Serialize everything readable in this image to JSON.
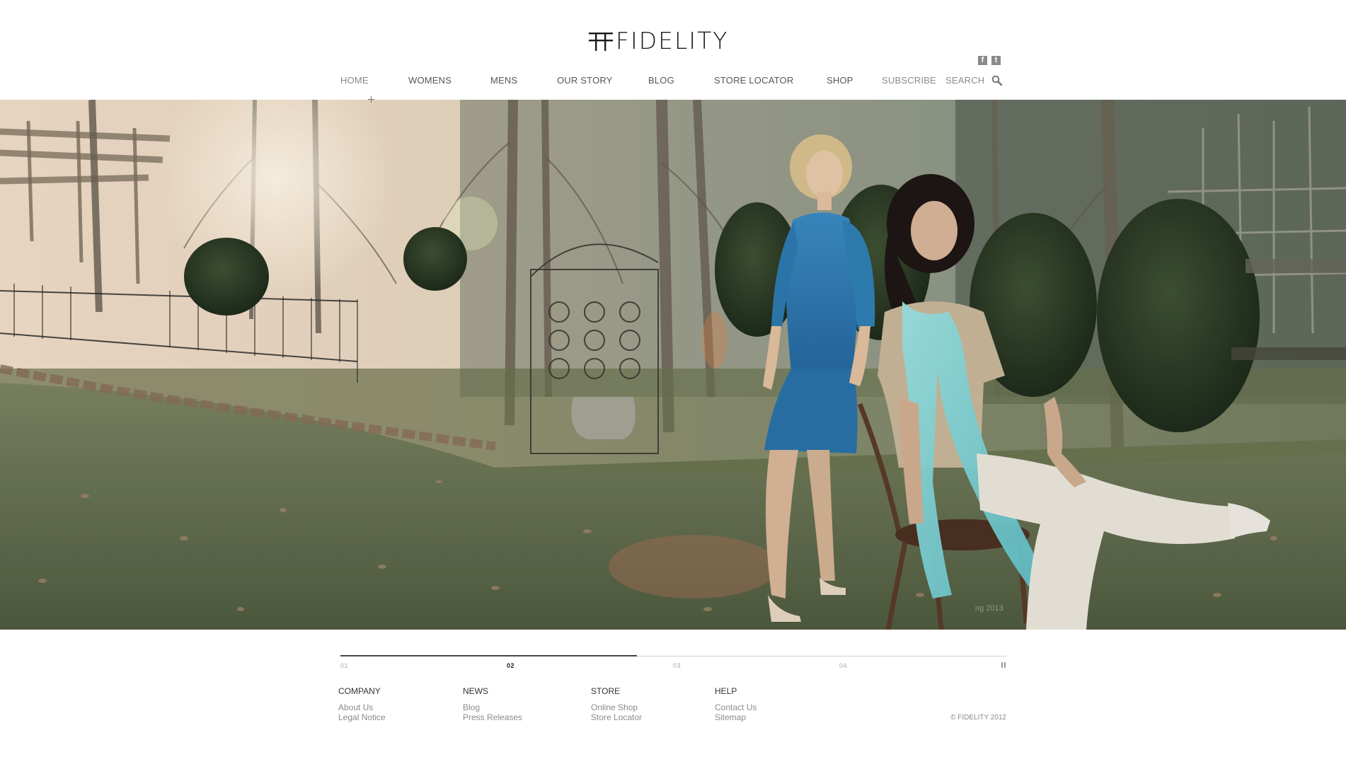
{
  "brand": {
    "name": "FIDELITY"
  },
  "social": [
    {
      "name": "facebook-icon",
      "glyph": "f"
    },
    {
      "name": "twitter-icon",
      "glyph": "t"
    }
  ],
  "nav": {
    "items": [
      {
        "label": "HOME",
        "active": true
      },
      {
        "label": "WOMENS"
      },
      {
        "label": "MENS"
      },
      {
        "label": "OUR STORY"
      },
      {
        "label": "BLOG"
      },
      {
        "label": "STORE LOCATOR"
      },
      {
        "label": "SHOP"
      },
      {
        "label": "SUBSCRIBE"
      },
      {
        "label": "SEARCH"
      }
    ]
  },
  "hero": {
    "watermark": "ng 2013",
    "colors": {
      "sky": "#f1ddc8",
      "grass": "#5d6b4a",
      "dress": "#2f7fb4",
      "scarf": "#7fd4d6"
    }
  },
  "slider": {
    "slides": [
      "01",
      "02",
      "03",
      "04"
    ],
    "active_index": 1,
    "progress": 0.445
  },
  "footer": {
    "columns": [
      {
        "heading": "COMPANY",
        "links": [
          "About Us",
          "Legal Notice"
        ]
      },
      {
        "heading": "NEWS",
        "links": [
          "Blog",
          "Press Releases"
        ]
      },
      {
        "heading": "STORE",
        "links": [
          "Online Shop",
          "Store Locator"
        ]
      },
      {
        "heading": "HELP",
        "links": [
          "Contact Us",
          "Sitemap"
        ]
      }
    ],
    "copyright": "© FIDELITY 2012"
  }
}
